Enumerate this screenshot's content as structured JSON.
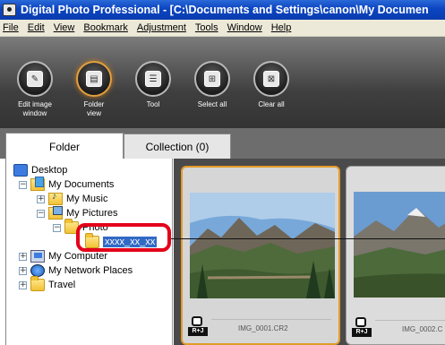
{
  "window": {
    "title": "Digital Photo Professional - [C:\\Documents and Settings\\canon\\My Documen"
  },
  "menu": [
    "File",
    "Edit",
    "View",
    "Bookmark",
    "Adjustment",
    "Tools",
    "Window",
    "Help"
  ],
  "toolbar": [
    {
      "label": "Edit image\nwindow",
      "icon": "edit-image-icon",
      "active": false
    },
    {
      "label": "Folder\nview",
      "icon": "folder-view-icon",
      "active": true
    },
    {
      "label": "Tool",
      "icon": "tool-palette-icon",
      "active": false
    },
    {
      "label": "Select all",
      "icon": "select-all-icon",
      "active": false
    },
    {
      "label": "Clear all",
      "icon": "clear-all-icon",
      "active": false
    }
  ],
  "tabs": {
    "folder": "Folder",
    "collection": "Collection (0)"
  },
  "tree": {
    "desktop": "Desktop",
    "my_documents": "My Documents",
    "my_music": "My Music",
    "my_pictures": "My Pictures",
    "photo": "Photo",
    "xxxx": "xxxx_xx_xx",
    "my_computer": "My Computer",
    "my_network": "My Network Places",
    "travel": "Travel"
  },
  "thumbnails": [
    {
      "file": "IMG_0001.CR2",
      "badge": "R+J",
      "selected": true
    },
    {
      "file": "IMG_0002.C",
      "badge": "R+J",
      "selected": false
    }
  ],
  "colors": {
    "highlight": "#e3001a",
    "selection": "#316ac5",
    "thumb_selected_border": "#e39a2a"
  }
}
